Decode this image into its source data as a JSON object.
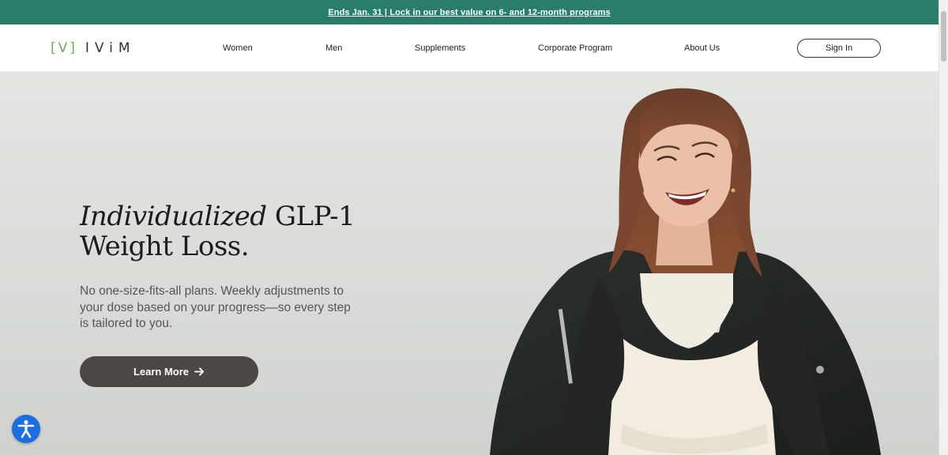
{
  "announcement": {
    "text": "Ends Jan. 31 | Lock in our best value on 6- and 12-month programs",
    "background": "#2a7d6a"
  },
  "header": {
    "logo": {
      "mark": "[V]",
      "word": "IViM",
      "mark_color": "#6db04a"
    },
    "nav": [
      {
        "label": "Women"
      },
      {
        "label": "Men"
      },
      {
        "label": "Supplements"
      },
      {
        "label": "Corporate Program"
      },
      {
        "label": "About Us"
      }
    ],
    "sign_in_label": "Sign In"
  },
  "hero": {
    "headline_italic": "Individualized",
    "headline_rest": "GLP-1",
    "headline_line2": "Weight Loss.",
    "subtext": "No one-size-fits-all plans. Weekly adjustments to your dose based on your progress—so every step is tailored to you.",
    "cta_label": "Learn More",
    "cta_icon": "arrow-right-icon",
    "cta_color": "#4a4744"
  },
  "accessibility": {
    "icon": "accessibility-icon",
    "color": "#1a6fe0"
  }
}
